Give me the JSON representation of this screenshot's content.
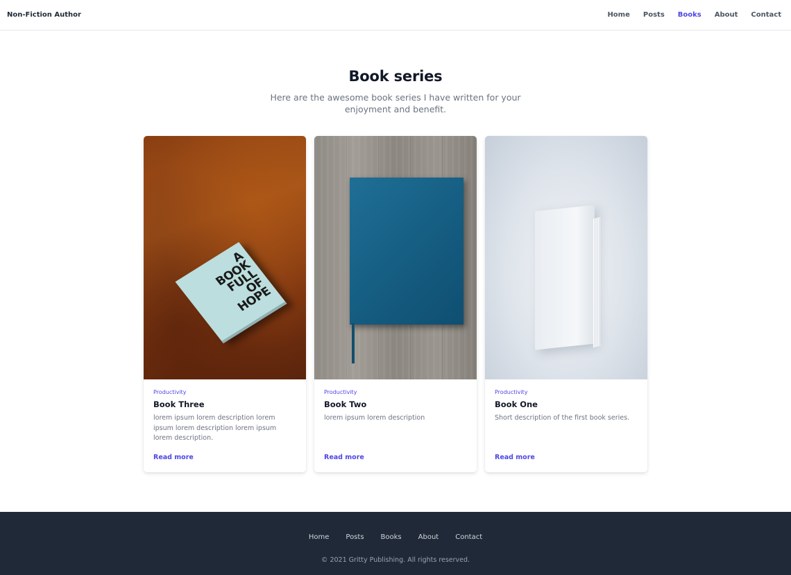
{
  "header": {
    "brand": "Non-Fiction Author",
    "nav": [
      {
        "label": "Home"
      },
      {
        "label": "Posts"
      },
      {
        "label": "Books"
      },
      {
        "label": "About"
      },
      {
        "label": "Contact"
      }
    ],
    "active": "Books"
  },
  "hero": {
    "title": "Book series",
    "subtitle": "Here are the awesome book series I have written for your enjoyment and benefit."
  },
  "cards": [
    {
      "image_icon": "book-full-of-hope-image",
      "cover_text": [
        "A",
        "BOOK",
        "FULL",
        "OF",
        "HOPE"
      ],
      "tag": "Productivity",
      "title": "Book Three",
      "description": "lorem ipsum lorem description lorem ipsum lorem description lorem ipsum lorem description.",
      "link": "Read more"
    },
    {
      "image_icon": "blue-notebook-image",
      "tag": "Productivity",
      "title": "Book Two",
      "description": "lorem ipsum lorem description",
      "link": "Read more"
    },
    {
      "image_icon": "white-book-image",
      "tag": "Productivity",
      "title": "Book One",
      "description": "Short description of the first book series.",
      "link": "Read more"
    }
  ],
  "footer": {
    "nav": [
      {
        "label": "Home"
      },
      {
        "label": "Posts"
      },
      {
        "label": "Books"
      },
      {
        "label": "About"
      },
      {
        "label": "Contact"
      }
    ],
    "copyright": "© 2021 Gritty Publishing. All rights reserved."
  },
  "colors": {
    "accent": "#4f46e5",
    "footer_bg": "#1f2937",
    "text_muted": "#6b7280"
  }
}
